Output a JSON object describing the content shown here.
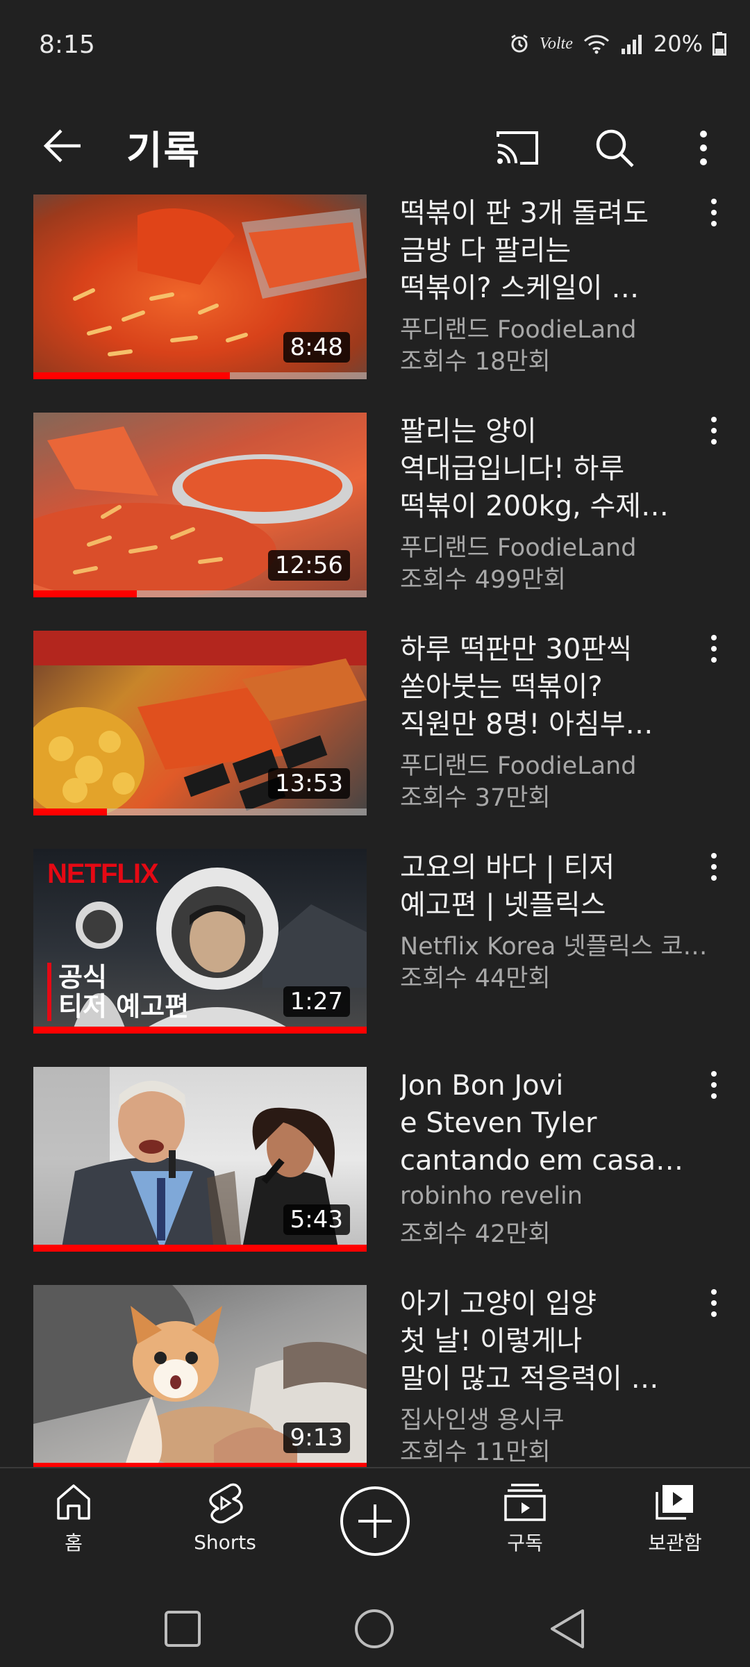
{
  "status_bar": {
    "time": "8:15",
    "volte": "Volte",
    "battery": "20%"
  },
  "app_bar": {
    "title": "기록"
  },
  "videos": [
    {
      "title_lines": [
        "떡볶이 판 3개 돌려도",
        "금방 다 팔리는",
        "떡볶이? 스케일이 …"
      ],
      "channel": "푸디랜드 FoodieLand",
      "views": "조회수 18만회",
      "duration": "8:48",
      "progress": 0.59
    },
    {
      "title_lines": [
        "팔리는 양이",
        "역대급입니다! 하루",
        "떡볶이 200kg, 수제…"
      ],
      "channel": "푸디랜드 FoodieLand",
      "views": "조회수 499만회",
      "duration": "12:56",
      "progress": 0.31
    },
    {
      "title_lines": [
        "하루 떡판만 30판씩",
        "쏟아붓는 떡볶이?",
        "직원만 8명! 아침부…"
      ],
      "channel": "푸디랜드 FoodieLand",
      "views": "조회수 37만회",
      "duration": "13:53",
      "progress": 0.22
    },
    {
      "title_lines": [
        "고요의 바다 | 티저",
        "예고편 | 넷플릭스"
      ],
      "channel": "Netflix Korea 넷플릭스 코…",
      "views": "조회수 44만회",
      "duration": "1:27",
      "progress": 1.0,
      "thumb_text": {
        "brand": "NETFLIX",
        "line1": "공식",
        "line2": "티저 예고편"
      }
    },
    {
      "title_lines": [
        "Jon Bon Jovi",
        "e Steven Tyler",
        "cantando em casa…"
      ],
      "channel": "robinho revelin",
      "views": "조회수 42만회",
      "duration": "5:43",
      "progress": 1.0
    },
    {
      "title_lines": [
        "아기 고양이 입양",
        "첫 날! 이렇게나",
        "말이 많고 적응력이 …"
      ],
      "channel": "집사인생 용시쿠",
      "views": "조회수 11만회",
      "duration": "9:13",
      "progress": 1.0
    }
  ],
  "bottom_nav": {
    "home": "홈",
    "shorts": "Shorts",
    "subscriptions": "구독",
    "library": "보관함"
  },
  "colors": {
    "background": "#212121",
    "progress": "#ff0000",
    "secondary_text": "#a8a8a8"
  }
}
